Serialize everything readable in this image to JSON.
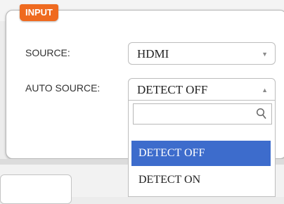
{
  "panel": {
    "tag": "INPUT"
  },
  "source": {
    "label": "SOURCE:",
    "value": "HDMI"
  },
  "auto_source": {
    "label": "AUTO SOURCE:",
    "value": "DETECT OFF",
    "search_value": "",
    "options": [
      {
        "label": "DETECT OFF",
        "selected": true
      },
      {
        "label": "DETECT ON",
        "selected": false
      }
    ]
  },
  "colors": {
    "tag_bg": "#ef6a1f",
    "selected_bg": "#3d6ccc"
  },
  "icons": {
    "source_arrow": "chevron-down-icon",
    "auto_arrow": "chevron-up-icon",
    "search": "search-icon"
  }
}
